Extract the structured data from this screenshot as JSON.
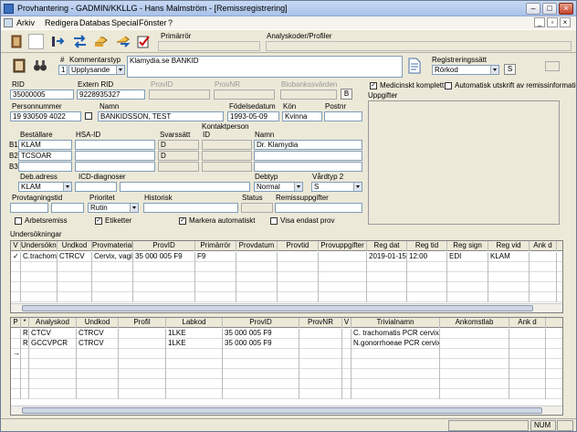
{
  "window": {
    "title": "Provhantering - GADMIN/KKLLG - Hans Malmström - [Remissregistrering]"
  },
  "menu": [
    "Arkiv",
    "Redigera",
    "Databas",
    "Special",
    "Fönster",
    "?"
  ],
  "toolbar": {
    "primarror_label": "Primärrör",
    "analyskoder_label": "Analyskoder/Profiler"
  },
  "form": {
    "kommentarstyp_label": "Kommentarstyp",
    "kommentar_num": "1",
    "kommentarstyp": "Upplysande",
    "kommentar": "Klamydia.se BANKID",
    "registreringssatt_label": "Registreringssätt",
    "registreringssatt": "Rörkod",
    "s_label": "S",
    "rid_label": "RID",
    "rid": "35000005",
    "extern_rid_label": "Extern RID",
    "extern_rid": "9228935327",
    "provid_label": "ProvID",
    "provnr_label": "ProvNR",
    "biobank_label": "Biobankssvärden",
    "b_label": "B",
    "medicinskt_label": "Medicinskt komplett",
    "automatisk_utskrift_label": "Automatisk utskrift av remissinformation",
    "uppgifter_label": "Uppgifter",
    "personnummer_label": "Personnummer",
    "personnummer": "19  930509 4022",
    "namn_label": "Namn",
    "namn": "BANKIDSSON, TEST",
    "fodelsedatum_label": "Födelsedatum",
    "fodelsedatum": "1993-05-09",
    "kon_label": "Kön",
    "kon": "Kvinna",
    "postnr_label": "Postnr",
    "bestallare_label": "Beställare",
    "hsaid_label": "HSA-ID",
    "svarssatt_label": "Svarssätt",
    "kontaktperson_label": "Kontaktperson",
    "id_label": "ID",
    "kp_namn_label": "Namn",
    "b1_label": "B1",
    "b1": "KLAM",
    "b1_svar": "D",
    "b1_kp": "Dr. Klamydia",
    "b2_label": "B2",
    "b2": "TCSOAR",
    "b2_svar": "D",
    "b3_label": "B3",
    "debadress_label": "Deb.adress",
    "debadress": "KLAM",
    "icd_label": "ICD-diagnoser",
    "debtyp_label": "Debtyp",
    "debtyp": "Normal",
    "vardtyp_label": "Vårdtyp 2",
    "vardtyp": "S",
    "provtagningstid_label": "Provtagningstid",
    "prioritet_label": "Prioritet",
    "prioritet": "Rutin",
    "historisk_label": "Historisk",
    "status_label": "Status",
    "remissuppgifter_label": "Remissuppgifter",
    "arbetsremiss_label": "Arbetsremiss",
    "etiketter_label": "Etiketter",
    "markera_label": "Markera automatiskt",
    "visa_endast_label": "Visa endast prov"
  },
  "undersokningar": {
    "label": "Undersökningar",
    "columns": [
      "V",
      "Undersökning",
      "Undkod",
      "Provmaterial",
      "ProvID",
      "Primärrör",
      "Provdatum",
      "Provtid",
      "Provuppgifter",
      "Reg dat",
      "Reg tid",
      "Reg sign",
      "Reg vid",
      "Ank d"
    ],
    "rows": [
      [
        "✓",
        "C.trachomatis",
        "CTRCV",
        "Cervix, vagina",
        "35 000 005 F9",
        "F9",
        "",
        "",
        "",
        "2019-01-15",
        "12:00",
        "EDI",
        "KLAM",
        ""
      ]
    ]
  },
  "analyser": {
    "columns": [
      "P",
      "*",
      "Analyskod",
      "Undkod",
      "Profil",
      "Labkod",
      "ProvID",
      "ProvNR",
      "V",
      "Trivialnamn",
      "Ankomstlab",
      "Ank d"
    ],
    "rows": [
      [
        "",
        "R",
        "CTCV",
        "CTRCV",
        "",
        "1LKE",
        "35 000 005 F9",
        "",
        "",
        "C. trachomatis PCR cervix/vagina",
        "",
        ""
      ],
      [
        "",
        "R",
        "GCCVPCR",
        "CTRCV",
        "",
        "1LKE",
        "35 000 005 F9",
        "",
        "",
        "N.gonorrhoeae PCR cervix/vagina",
        "",
        ""
      ],
      [
        "→",
        "",
        "",
        "",
        "",
        "",
        "",
        "",
        "",
        "",
        "",
        ""
      ]
    ]
  },
  "status": {
    "num": "NUM"
  }
}
